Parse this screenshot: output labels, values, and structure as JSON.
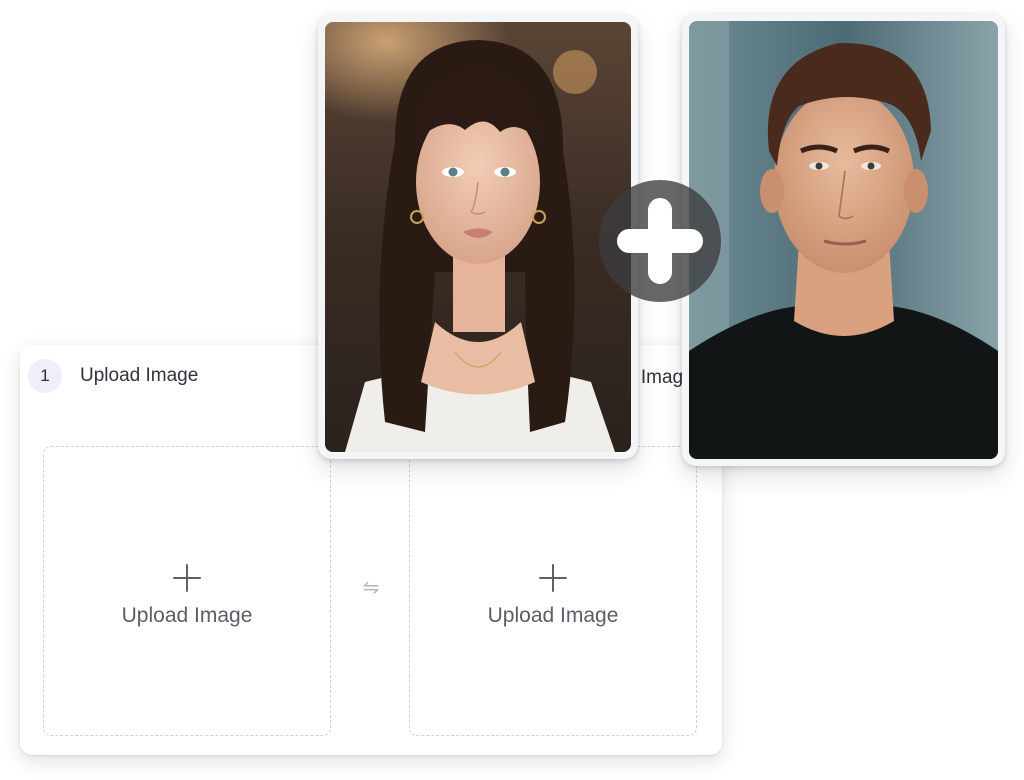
{
  "card": {
    "step_number": "1",
    "step_title": "Upload Image",
    "step2_partial": "o Imag",
    "left_upload_label": "Upload Image",
    "right_upload_label": "Upload Image",
    "swap_symbol": "⇋"
  },
  "photos": [
    {
      "subject": "woman-portrait"
    },
    {
      "subject": "man-portrait"
    }
  ],
  "colors": {
    "badge_bg": "#f1eefb",
    "dashed_border": "#cfd3d8",
    "plus_overlay": "#3c3c3e"
  }
}
